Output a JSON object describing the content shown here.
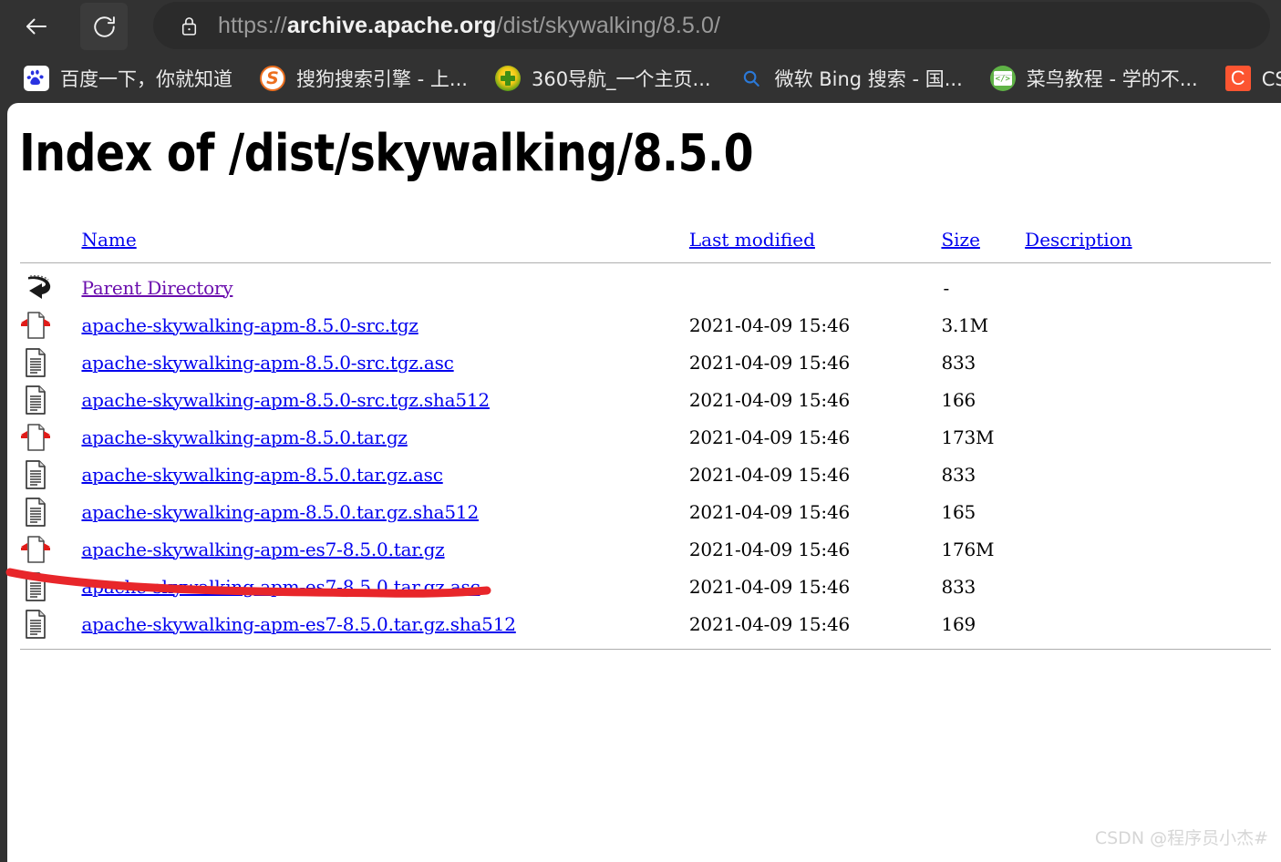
{
  "browser": {
    "back_label": "Back",
    "reload_label": "Reload",
    "security_icon": "lock-icon",
    "url_scheme": "https://",
    "url_host": "archive.apache.org",
    "url_path": "/dist/skywalking/8.5.0/",
    "bookmarks": [
      {
        "icon": "baidu-icon",
        "label": "百度一下，你就知道"
      },
      {
        "icon": "sogou-icon",
        "label": "搜狗搜索引擎 - 上...",
        "glyph": "S"
      },
      {
        "icon": "360-icon",
        "label": "360导航_一个主页..."
      },
      {
        "icon": "bing-search-icon",
        "label": "微软 Bing 搜索 - 国...",
        "glyph": "⌕"
      },
      {
        "icon": "runoob-icon",
        "label": "菜鸟教程 - 学的不...",
        "glyph": "</>"
      },
      {
        "icon": "csdn-icon",
        "label": "CSDN-专业IT技",
        "glyph": "C"
      }
    ]
  },
  "page": {
    "title": "Index of /dist/skywalking/8.5.0",
    "columns": [
      {
        "key": "name",
        "label": "Name"
      },
      {
        "key": "last_modified",
        "label": "Last modified"
      },
      {
        "key": "size",
        "label": "Size"
      },
      {
        "key": "description",
        "label": "Description"
      }
    ],
    "rows": [
      {
        "icon": "parent-directory-icon",
        "name": "Parent Directory",
        "visited": true,
        "last_modified": "",
        "size": "-",
        "description": ""
      },
      {
        "icon": "compressed-file-icon",
        "name": "apache-skywalking-apm-8.5.0-src.tgz",
        "last_modified": "2021-04-09 15:46",
        "size": "3.1M",
        "description": ""
      },
      {
        "icon": "text-file-icon",
        "name": "apache-skywalking-apm-8.5.0-src.tgz.asc",
        "last_modified": "2021-04-09 15:46",
        "size": "833",
        "description": ""
      },
      {
        "icon": "text-file-icon",
        "name": "apache-skywalking-apm-8.5.0-src.tgz.sha512",
        "last_modified": "2021-04-09 15:46",
        "size": "166",
        "description": ""
      },
      {
        "icon": "compressed-file-icon",
        "name": "apache-skywalking-apm-8.5.0.tar.gz",
        "last_modified": "2021-04-09 15:46",
        "size": "173M",
        "description": ""
      },
      {
        "icon": "text-file-icon",
        "name": "apache-skywalking-apm-8.5.0.tar.gz.asc",
        "last_modified": "2021-04-09 15:46",
        "size": "833",
        "description": ""
      },
      {
        "icon": "text-file-icon",
        "name": "apache-skywalking-apm-8.5.0.tar.gz.sha512",
        "last_modified": "2021-04-09 15:46",
        "size": "165",
        "description": ""
      },
      {
        "icon": "compressed-file-icon",
        "name": "apache-skywalking-apm-es7-8.5.0.tar.gz",
        "last_modified": "2021-04-09 15:46",
        "size": "176M",
        "description": ""
      },
      {
        "icon": "text-file-icon",
        "name": "apache-skywalking-apm-es7-8.5.0.tar.gz.asc",
        "last_modified": "2021-04-09 15:46",
        "size": "833",
        "description": ""
      },
      {
        "icon": "text-file-icon",
        "name": "apache-skywalking-apm-es7-8.5.0.tar.gz.sha512",
        "last_modified": "2021-04-09 15:46",
        "size": "169",
        "description": ""
      }
    ]
  },
  "annotation": {
    "type": "hand-drawn-underline",
    "color": "#e8262a"
  },
  "watermark": {
    "text": "CSDN @程序员小杰#"
  }
}
